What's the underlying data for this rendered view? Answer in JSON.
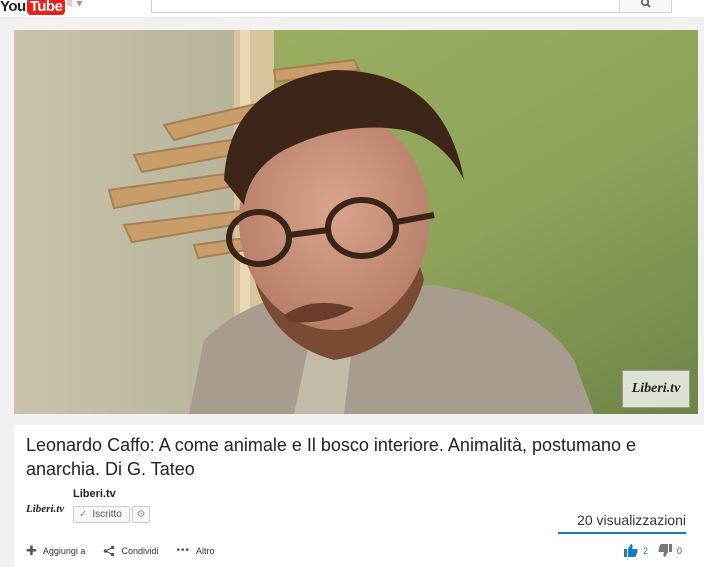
{
  "masthead": {
    "logo_you": "You",
    "logo_tube": "Tube"
  },
  "video": {
    "watermark": "Liberi.tv"
  },
  "info": {
    "title": "Leonardo Caffo: A come animale e Il bosco interiore. Animalità, postumano e anarchia. Di G. Tateo",
    "channel_logo": "Liberi.tv",
    "channel_name": "Liberi.tv",
    "subscribe_label": "Iscritto",
    "views": "20 visualizzazioni"
  },
  "actions": {
    "add_label": "Aggiungi a",
    "share_label": "Condividi",
    "more_label": "Altro"
  },
  "ratings": {
    "likes": "2",
    "dislikes": "0"
  },
  "colors": {
    "brand_red": "#e62117",
    "accent_blue": "#167ac6"
  }
}
